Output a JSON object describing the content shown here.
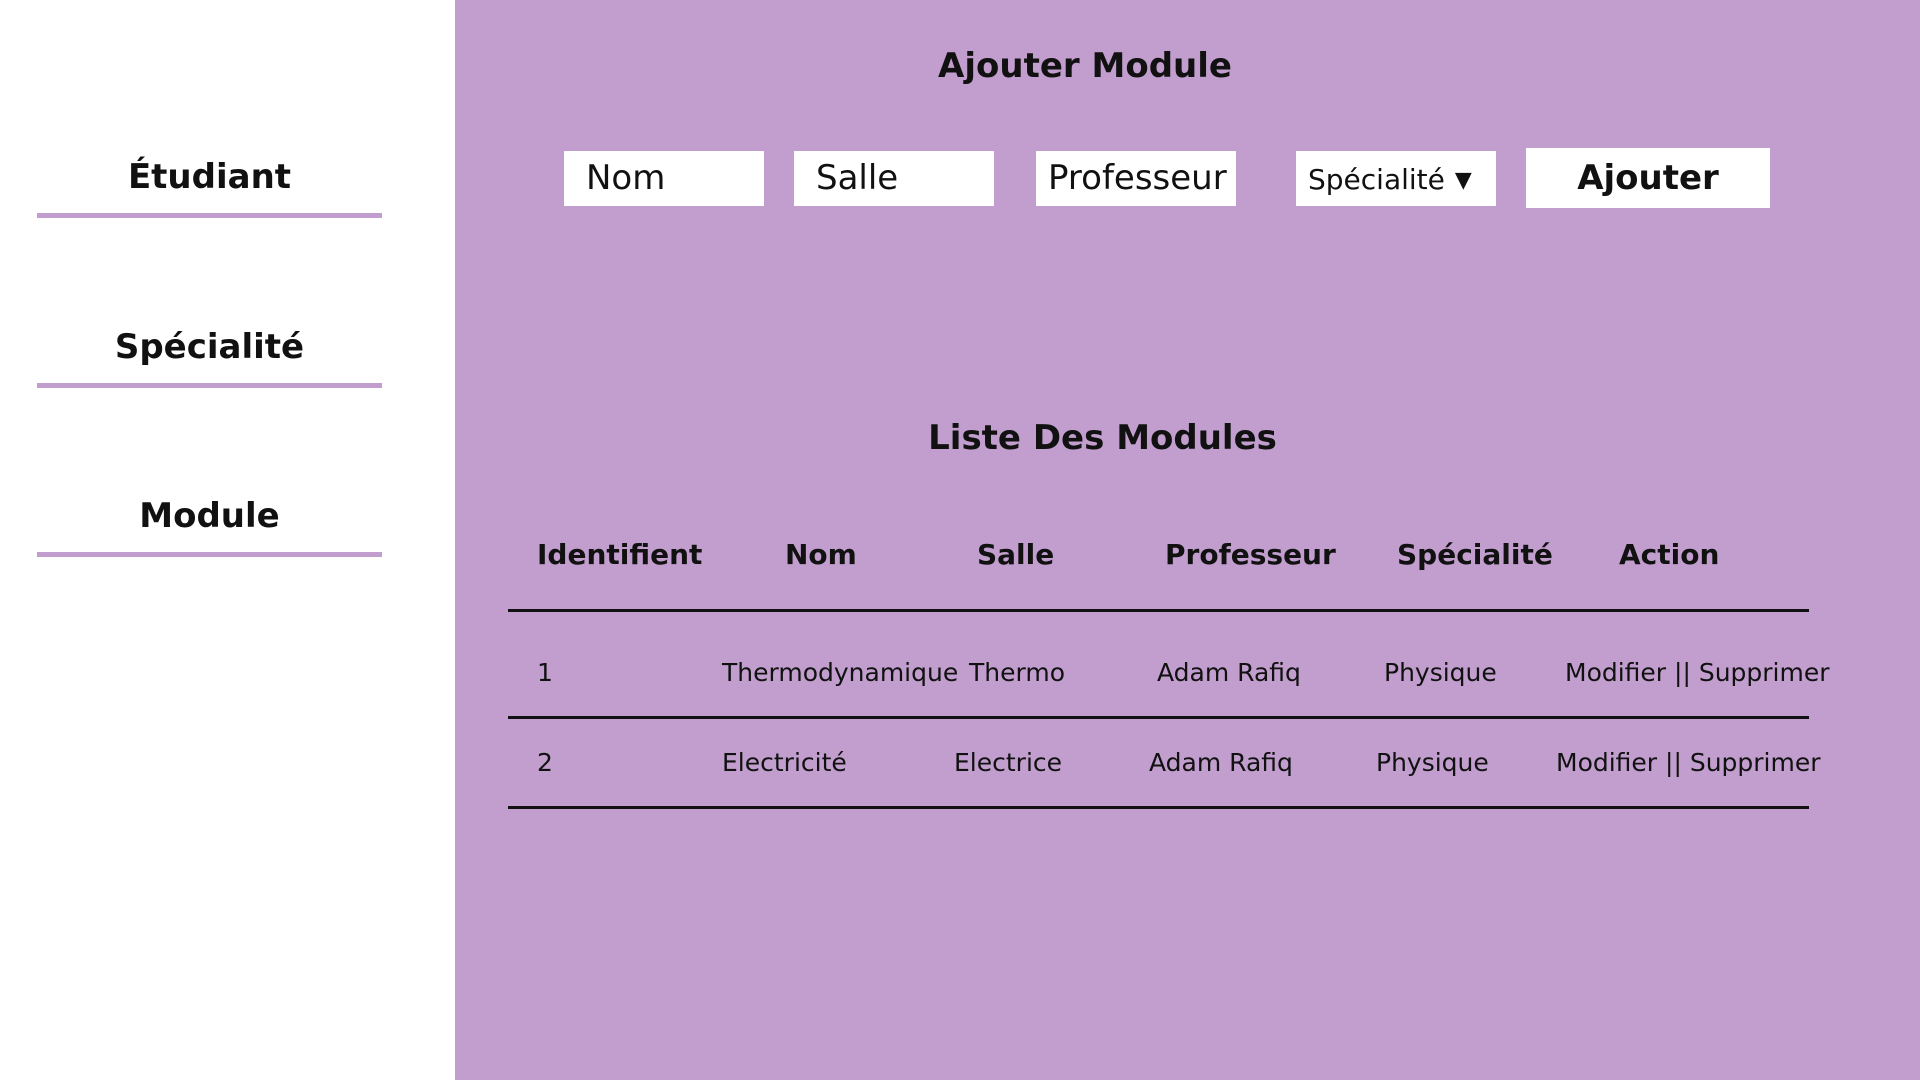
{
  "sidebar": {
    "items": [
      {
        "label": "Étudiant"
      },
      {
        "label": "Spécialité"
      },
      {
        "label": "Module"
      }
    ]
  },
  "form": {
    "title": "Ajouter Module",
    "nom_placeholder": "Nom",
    "salle_placeholder": "Salle",
    "professeur_placeholder": "Professeur",
    "specialite_select": "Spécialité",
    "submit_label": "Ajouter"
  },
  "table": {
    "title": "Liste Des Modules",
    "headers": [
      "Identifient",
      "Nom",
      "Salle",
      "Professeur",
      "Spécialité",
      "Action"
    ],
    "rows": [
      {
        "id": "1",
        "nom": "Thermodynamique",
        "salle": "Thermo",
        "professeur": "Adam Rafiq",
        "specialite": "Physique",
        "action": "Modifier || Supprimer"
      },
      {
        "id": "2",
        "nom": "Electricité",
        "salle": "Electrice",
        "professeur": "Adam Rafiq",
        "specialite": "Physique",
        "action": "Modifier || Supprimer"
      }
    ]
  },
  "colors": {
    "accent": "#c19ecd",
    "background": "#ffffff",
    "text": "#111111"
  }
}
